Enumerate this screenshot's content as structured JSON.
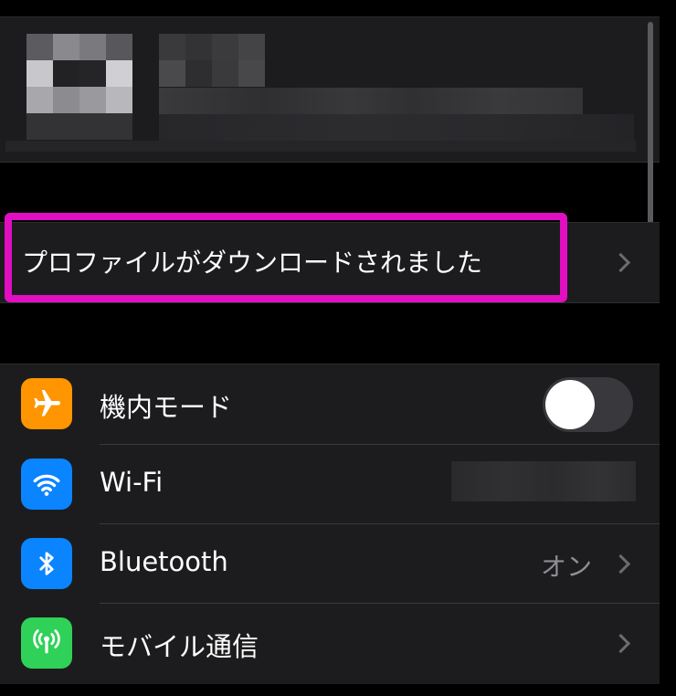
{
  "profile_banner": {
    "label": "プロファイルがダウンロードされました"
  },
  "settings_rows": [
    {
      "label": "機内モード",
      "icon": "airplane-icon",
      "icon_color": "#ff9500",
      "toggle_on": false
    },
    {
      "label": "Wi-Fi",
      "icon": "wifi-icon",
      "icon_color": "#0a84ff"
    },
    {
      "label": "Bluetooth",
      "icon": "bluetooth-icon",
      "icon_color": "#0a84ff",
      "value": "オン"
    },
    {
      "label": "モバイル通信",
      "icon": "antenna-icon",
      "icon_color": "#30d158"
    }
  ],
  "colors": {
    "highlight": "#e10ec2",
    "background": "#000000",
    "cell": "#1c1c1e"
  }
}
